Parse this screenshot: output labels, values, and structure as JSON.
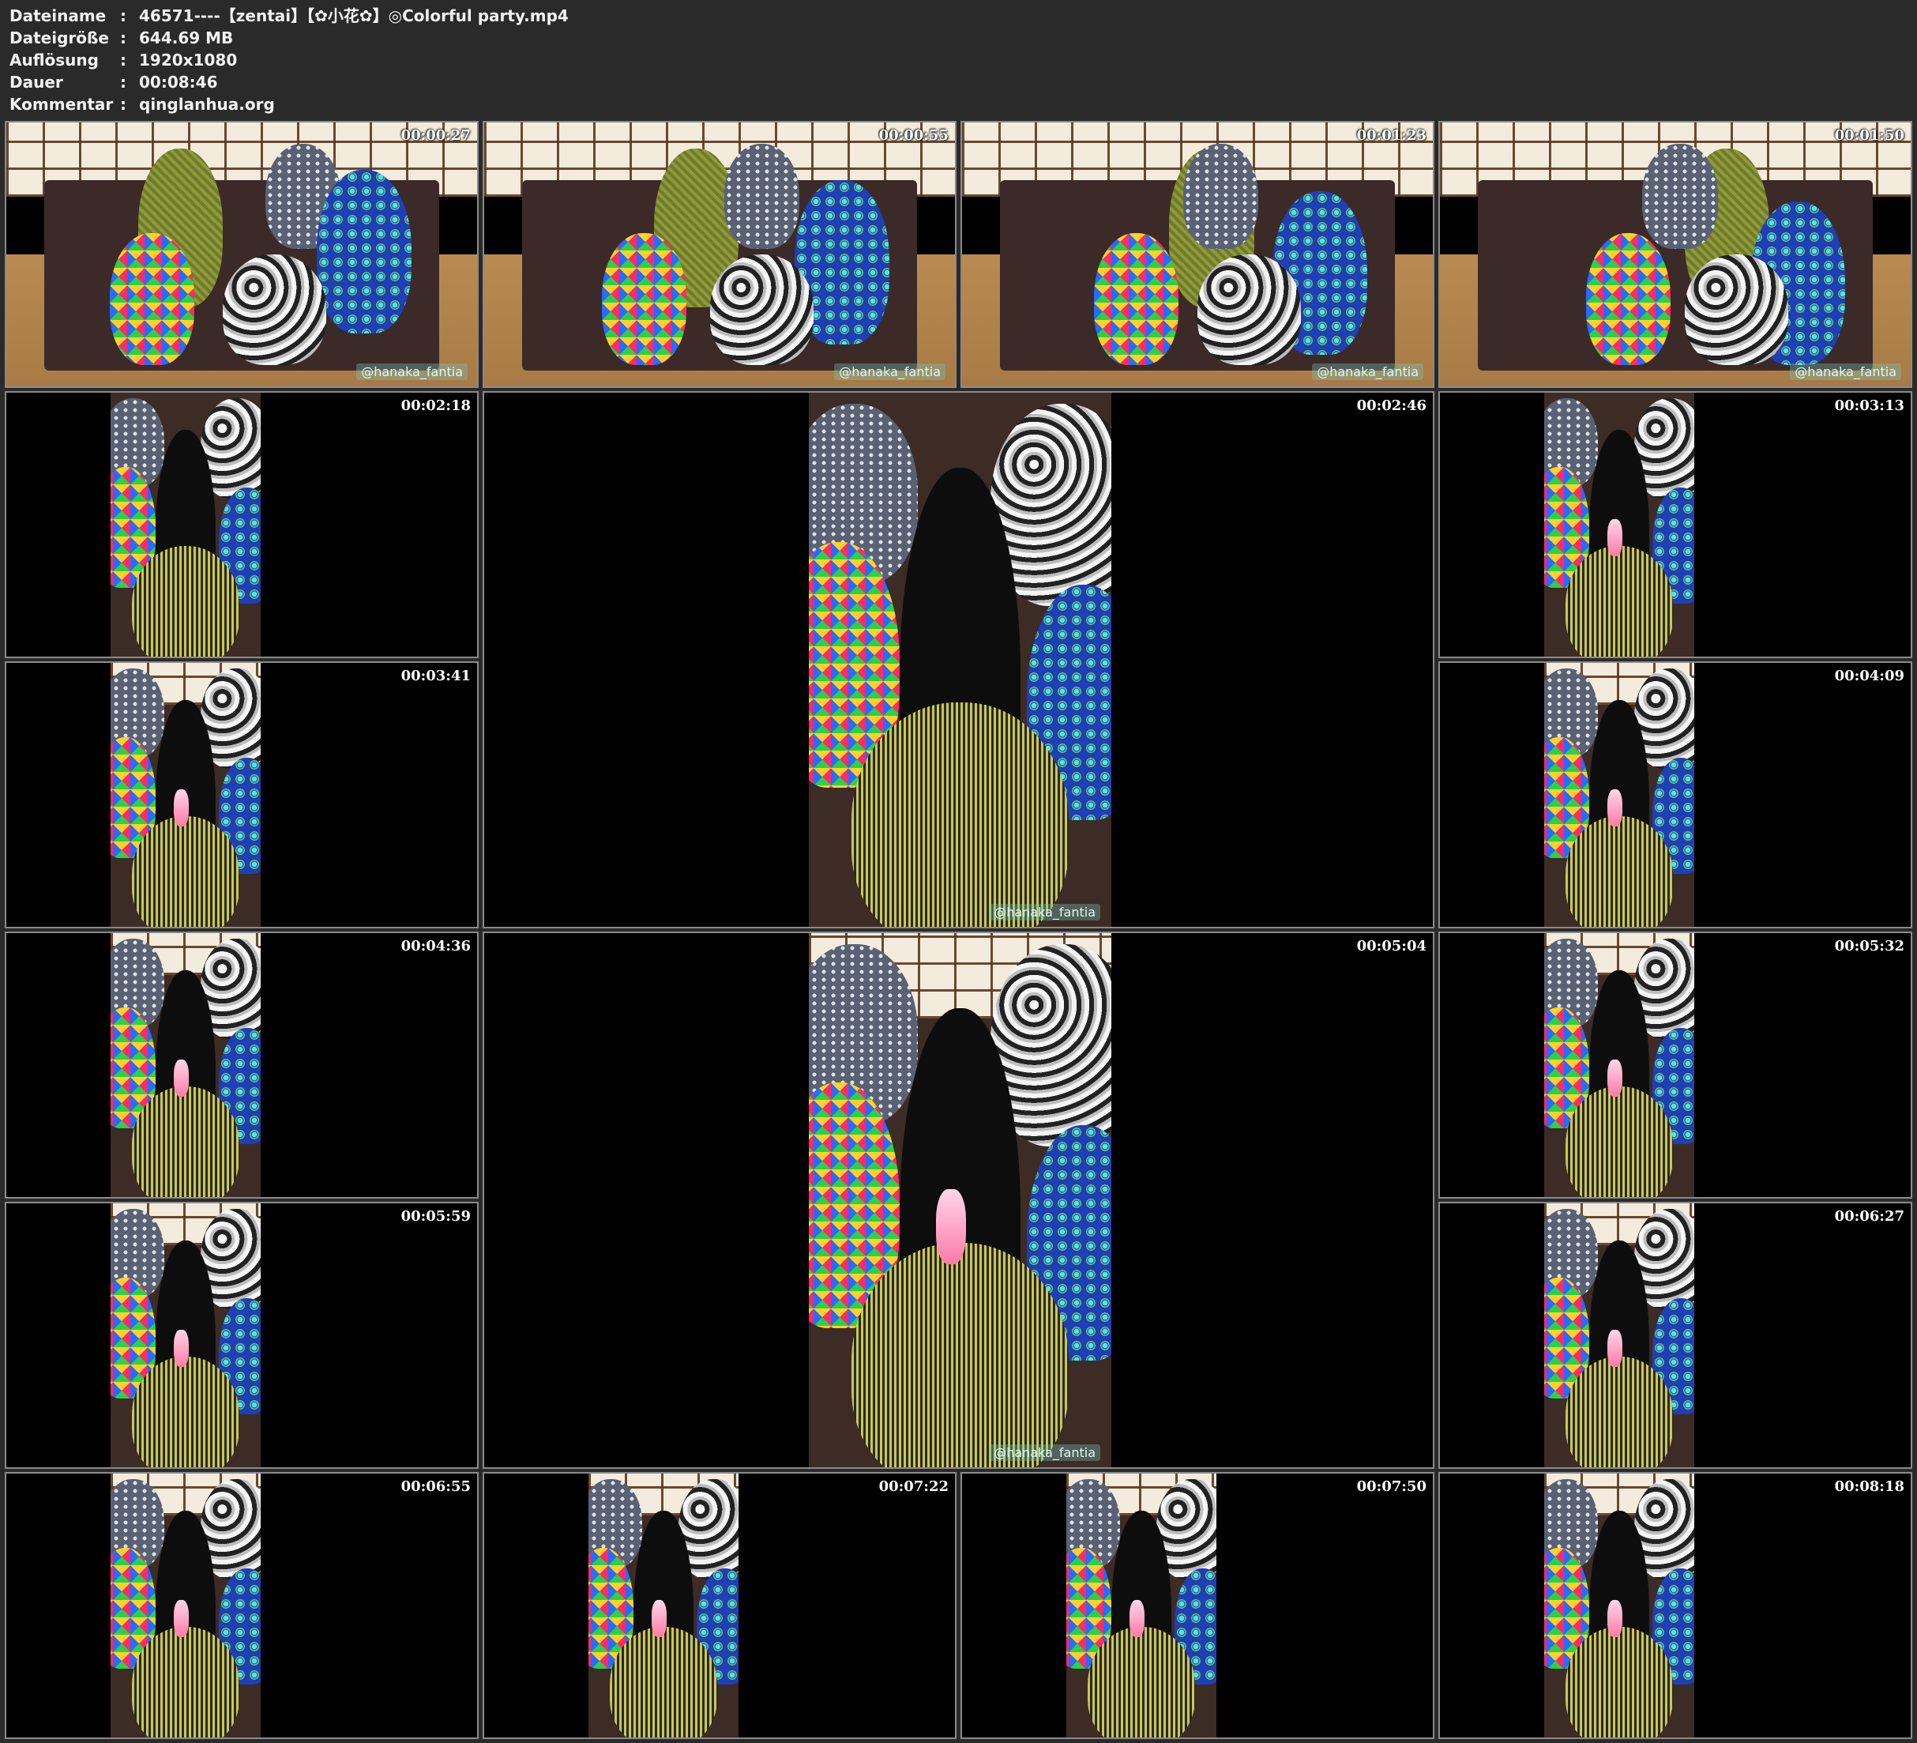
{
  "header": {
    "rows": [
      {
        "key": "Dateiname",
        "value": "46571----【zentai】【✿小花✿】◎Colorful party.mp4"
      },
      {
        "key": "Dateigröße",
        "value": "644.69 MB"
      },
      {
        "key": "Auflösung",
        "value": "1920x1080"
      },
      {
        "key": "Dauer",
        "value": "00:08:46"
      },
      {
        "key": "Kommentar",
        "value": "qinglanhua.org"
      }
    ],
    "separator": ":"
  },
  "thumbnails": [
    {
      "time": "00:00:27",
      "scene": "room",
      "watermark": "@hanaka_fantia"
    },
    {
      "time": "00:00:55",
      "scene": "room",
      "watermark": "@hanaka_fantia"
    },
    {
      "time": "00:01:23",
      "scene": "room",
      "watermark": "@hanaka_fantia"
    },
    {
      "time": "00:01:50",
      "scene": "room",
      "watermark": "@hanaka_fantia"
    },
    {
      "time": "00:02:18",
      "scene": "portrait",
      "watermark": ""
    },
    {
      "time": "00:02:46",
      "scene": "portrait-large",
      "watermark": "@hanaka_fantia"
    },
    {
      "time": "00:03:13",
      "scene": "portrait",
      "watermark": ""
    },
    {
      "time": "00:03:41",
      "scene": "portrait",
      "watermark": ""
    },
    {
      "time": "00:04:09",
      "scene": "portrait",
      "watermark": ""
    },
    {
      "time": "00:04:36",
      "scene": "portrait",
      "watermark": ""
    },
    {
      "time": "00:05:04",
      "scene": "portrait-large",
      "watermark": "@hanaka_fantia"
    },
    {
      "time": "00:05:32",
      "scene": "portrait",
      "watermark": ""
    },
    {
      "time": "00:05:59",
      "scene": "portrait",
      "watermark": ""
    },
    {
      "time": "00:06:27",
      "scene": "portrait",
      "watermark": ""
    },
    {
      "time": "00:06:55",
      "scene": "portrait",
      "watermark": ""
    },
    {
      "time": "00:07:22",
      "scene": "portrait",
      "watermark": ""
    },
    {
      "time": "00:07:50",
      "scene": "portrait",
      "watermark": ""
    },
    {
      "time": "00:08:18",
      "scene": "portrait",
      "watermark": ""
    }
  ],
  "colors": {
    "background": "#2a2a2a",
    "text": "#f2f2f2",
    "border": "#8a8a8a"
  }
}
